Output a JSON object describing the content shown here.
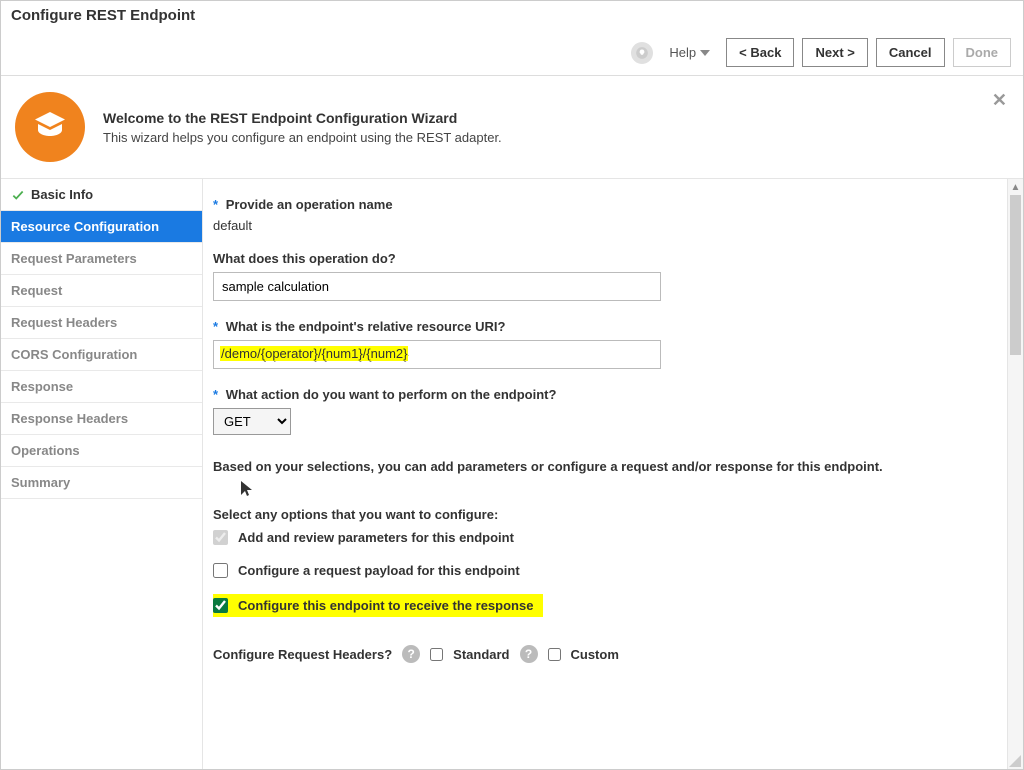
{
  "title": "Configure REST Endpoint",
  "toolbar": {
    "help_label": "Help",
    "back_label": "<  Back",
    "next_label": "Next  >",
    "cancel_label": "Cancel",
    "done_label": "Done"
  },
  "welcome": {
    "title": "Welcome to the REST Endpoint Configuration Wizard",
    "subtitle": "This wizard helps you configure an endpoint using the REST adapter.",
    "close_glyph": "✕"
  },
  "sidebar": {
    "items": [
      {
        "label": "Basic Info",
        "state": "done"
      },
      {
        "label": "Resource Configuration",
        "state": "active"
      },
      {
        "label": "Request Parameters",
        "state": "pending"
      },
      {
        "label": "Request",
        "state": "pending"
      },
      {
        "label": "Request Headers",
        "state": "pending"
      },
      {
        "label": "CORS Configuration",
        "state": "pending"
      },
      {
        "label": "Response",
        "state": "pending"
      },
      {
        "label": "Response Headers",
        "state": "pending"
      },
      {
        "label": "Operations",
        "state": "pending"
      },
      {
        "label": "Summary",
        "state": "pending"
      }
    ]
  },
  "form": {
    "operation_label": "Provide an operation name",
    "operation_value": "default",
    "description_label": "What does this operation do?",
    "description_value": "sample calculation",
    "uri_label": "What is the endpoint's relative resource URI?",
    "uri_value": "/demo/{operator}/{num1}/{num2}",
    "action_label": "What action do you want to perform on the endpoint?",
    "action_value": "GET",
    "note": "Based on your selections, you can add parameters or configure a request and/or response for this endpoint.",
    "options_label": "Select any options that you want to configure:",
    "opt_params": "Add and review parameters for this endpoint",
    "opt_request_payload": "Configure a request payload for this endpoint",
    "opt_response": "Configure this endpoint to receive the response",
    "headers_label": "Configure Request Headers?",
    "headers_standard": "Standard",
    "headers_custom": "Custom"
  }
}
